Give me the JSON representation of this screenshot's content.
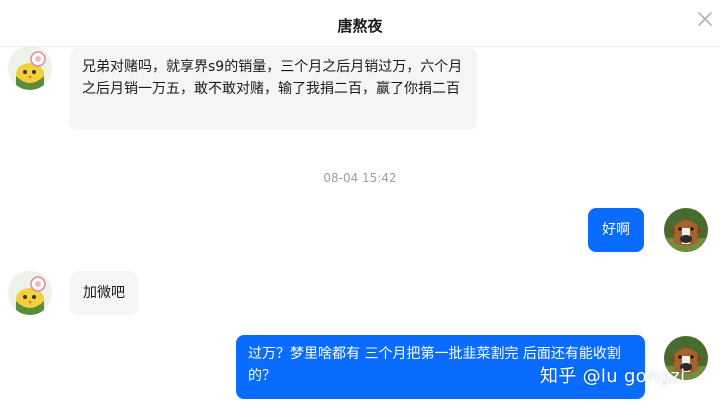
{
  "header": {
    "title": "唐熬夜",
    "close_icon": "close-icon"
  },
  "messages": [
    {
      "side": "left",
      "avatar": "cartoon-chick-avatar",
      "text": "兄弟对赌吗，就享界s9的销量，三个月之后月销过万，六个月之后月销一万五，敢不敢对赌，输了我捐二百，赢了你捐二百"
    },
    {
      "type": "timestamp",
      "text": "08-04 15:42"
    },
    {
      "side": "right",
      "avatar": "boxer-dog-avatar",
      "text": "好啊"
    },
    {
      "side": "left",
      "avatar": "cartoon-chick-avatar",
      "text": "加微吧"
    },
    {
      "side": "right",
      "avatar": "boxer-dog-avatar",
      "text": "过万？梦里啥都有   三个月把第一批韭菜割完  后面还有能收割的？"
    }
  ],
  "watermark": "知乎 @lu gongzi",
  "colors": {
    "outgoing_bubble": "#0a6cff",
    "incoming_bubble": "#f5f5f7",
    "timestamp": "#9aa0a6"
  }
}
